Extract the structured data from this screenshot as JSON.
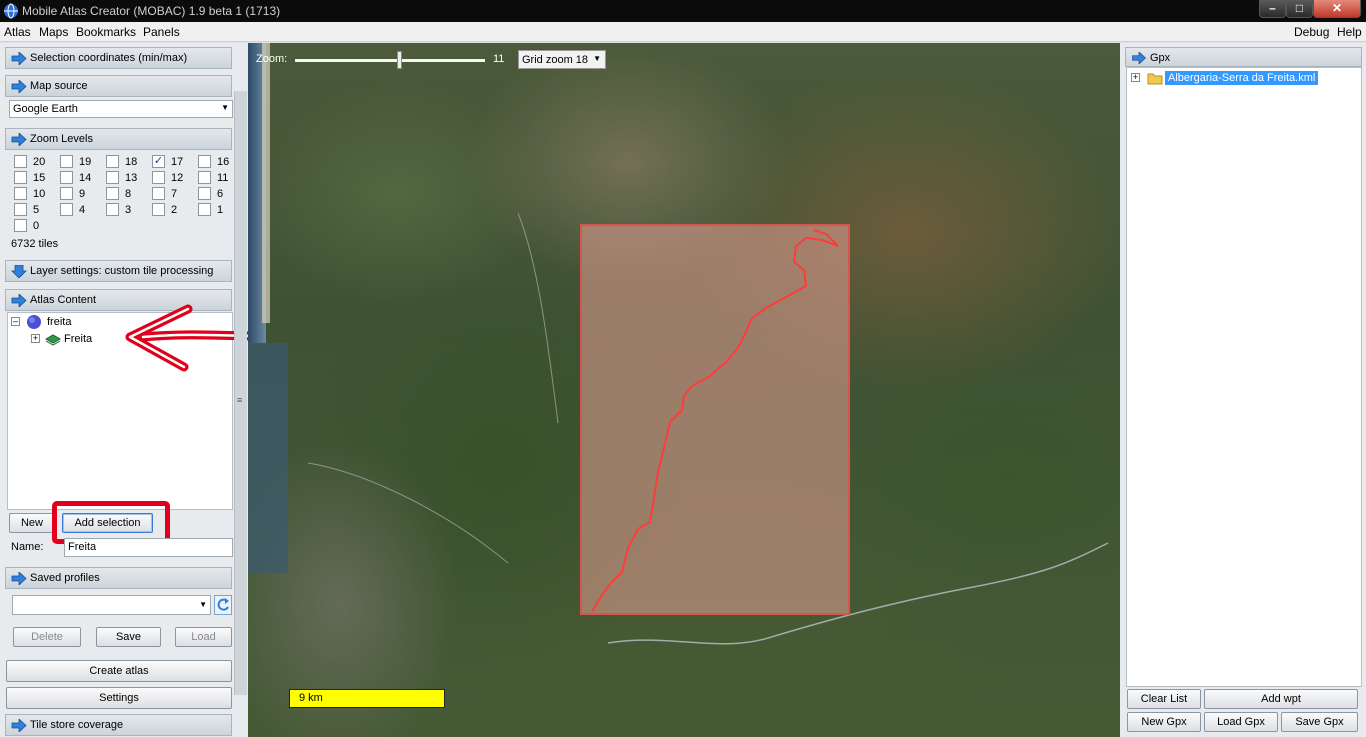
{
  "window": {
    "title": "Mobile Atlas Creator (MOBAC) 1.9 beta 1 (1713)"
  },
  "menu": {
    "left": [
      "Atlas",
      "Maps",
      "Bookmarks",
      "Panels"
    ],
    "right": [
      "Debug",
      "Help"
    ]
  },
  "left_panel": {
    "selection_coordinates": "Selection coordinates (min/max)",
    "map_source": {
      "title": "Map source",
      "value": "Google Earth"
    },
    "zoom_levels": {
      "title": "Zoom Levels",
      "levels": [
        {
          "label": "20",
          "checked": false
        },
        {
          "label": "19",
          "checked": false
        },
        {
          "label": "18",
          "checked": false
        },
        {
          "label": "17",
          "checked": true
        },
        {
          "label": "16",
          "checked": false
        },
        {
          "label": "15",
          "checked": false
        },
        {
          "label": "14",
          "checked": false
        },
        {
          "label": "13",
          "checked": false
        },
        {
          "label": "12",
          "checked": false
        },
        {
          "label": "11",
          "checked": false
        },
        {
          "label": "10",
          "checked": false
        },
        {
          "label": "9",
          "checked": false
        },
        {
          "label": "8",
          "checked": false
        },
        {
          "label": "7",
          "checked": false
        },
        {
          "label": "6",
          "checked": false
        },
        {
          "label": "5",
          "checked": false
        },
        {
          "label": "4",
          "checked": false
        },
        {
          "label": "3",
          "checked": false
        },
        {
          "label": "2",
          "checked": false
        },
        {
          "label": "1",
          "checked": false
        },
        {
          "label": "0",
          "checked": false
        }
      ],
      "tiles": "6732 tiles"
    },
    "layer_settings": "Layer settings: custom tile processing",
    "atlas_content": {
      "title": "Atlas Content",
      "root": "freita",
      "child": "Freita"
    },
    "buttons": {
      "new": "New",
      "add_selection": "Add selection"
    },
    "name_label": "Name:",
    "name_value": "Freita",
    "saved_profiles": {
      "title": "Saved profiles",
      "value": "",
      "delete": "Delete",
      "save": "Save",
      "load": "Load"
    },
    "create_atlas": "Create atlas",
    "settings": "Settings",
    "tile_store": "Tile store coverage"
  },
  "map": {
    "zoom_label": "Zoom:",
    "zoom_value": "11",
    "zoom_fraction": 0.55,
    "grid_zoom": "Grid zoom 18",
    "scale": "9 km"
  },
  "right_panel": {
    "title": "Gpx",
    "file": "Albergaria-Serra da Freita.kml",
    "buttons": {
      "clear_list": "Clear List",
      "add_wpt": "Add wpt",
      "new_gpx": "New Gpx",
      "load_gpx": "Load Gpx",
      "save_gpx": "Save Gpx"
    }
  },
  "colors": {
    "selection_border": "#d9534f",
    "annotation_red": "#e0001b",
    "tree_highlight": "#3399ff"
  }
}
